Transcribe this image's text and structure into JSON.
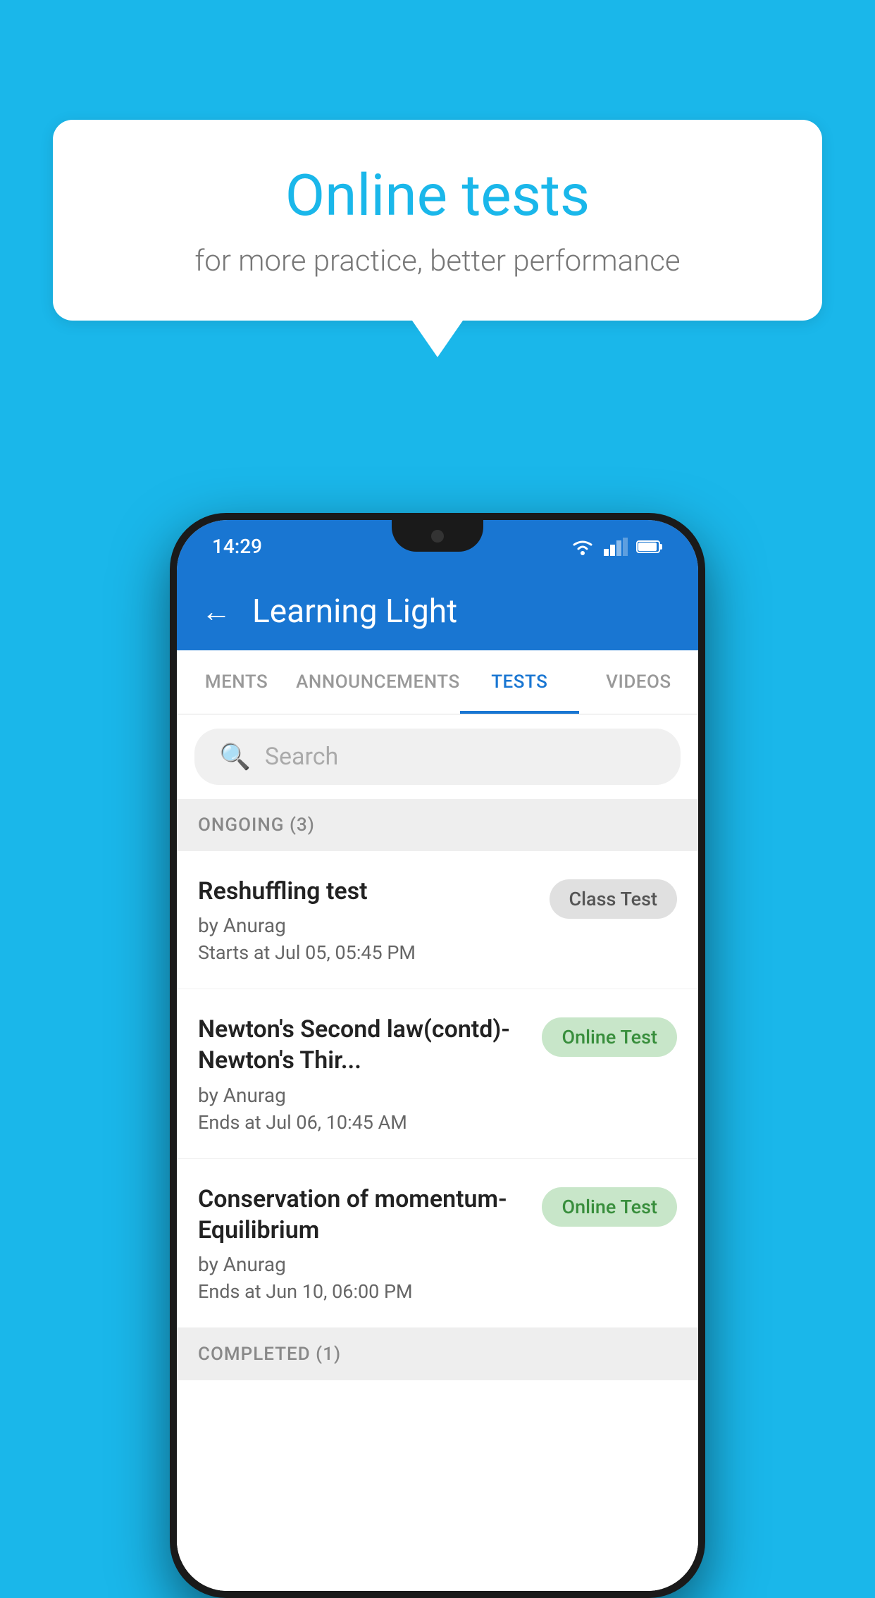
{
  "background_color": "#1ab7ea",
  "hero": {
    "bubble_title": "Online tests",
    "bubble_subtitle": "for more practice, better performance"
  },
  "phone": {
    "status_bar": {
      "time": "14:29"
    },
    "app_bar": {
      "title": "Learning Light",
      "back_label": "←"
    },
    "tabs": [
      {
        "label": "MENTS",
        "active": false
      },
      {
        "label": "ANNOUNCEMENTS",
        "active": false
      },
      {
        "label": "TESTS",
        "active": true
      },
      {
        "label": "VIDEOS",
        "active": false
      }
    ],
    "search": {
      "placeholder": "Search"
    },
    "ongoing_section": {
      "title": "ONGOING (3)"
    },
    "tests": [
      {
        "name": "Reshuffling test",
        "author": "by Anurag",
        "time_label": "Starts at",
        "time": "Jul 05, 05:45 PM",
        "badge": "Class Test",
        "badge_type": "class"
      },
      {
        "name": "Newton's Second law(contd)-Newton's Thir...",
        "author": "by Anurag",
        "time_label": "Ends at",
        "time": "Jul 06, 10:45 AM",
        "badge": "Online Test",
        "badge_type": "online"
      },
      {
        "name": "Conservation of momentum-Equilibrium",
        "author": "by Anurag",
        "time_label": "Ends at",
        "time": "Jun 10, 06:00 PM",
        "badge": "Online Test",
        "badge_type": "online"
      }
    ],
    "completed_section": {
      "title": "COMPLETED (1)"
    }
  }
}
